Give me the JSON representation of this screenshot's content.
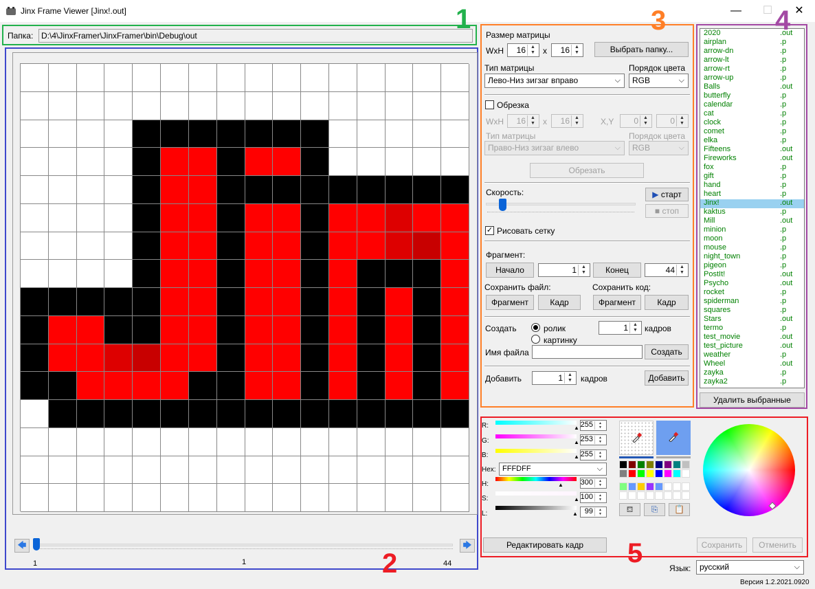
{
  "window": {
    "title": "Jinx Frame Viewer [Jinx!.out]",
    "minimize": "—",
    "maximize": "☐",
    "close": "✕"
  },
  "annotations": [
    "1",
    "2",
    "3",
    "4",
    "5"
  ],
  "folder": {
    "label": "Папка:",
    "path": "D:\\4\\JinxFramer\\JinxFramer\\bin\\Debug\\out"
  },
  "grid": {
    "rows": 16,
    "cols": 16,
    "cells": [
      "WWWWWWWWWWWWWWWW",
      "WWWWWWWWWWWWWWWW",
      "WWWWBBBBBBBWWWWW",
      "WWWWBRRBRRBWWWWW",
      "WWWWBRRBBBBBBBBB",
      "WWWWBRRBRRBRRrRR",
      "WWWWBRRBRRBRRrdR",
      "WWWWBRRBRRBRBBBR",
      "BBBBBRRBRRBRBRBR",
      "BRRBBRRBRRBRBRBR",
      "BRRrdRRBRRBRBRBR",
      "BBRRRRBBRRBRBRBR",
      "WBBBBBBBBBBBBBBB",
      "WWWWWWWWWWWWWWWW",
      "WWWWWWWWWWWWWWWW",
      "WWWWWWWWWWWWWWWW"
    ],
    "colors": {
      "W": "#ffffff",
      "B": "#000000",
      "R": "#ff0000",
      "r": "#dd0000",
      "d": "#c80000"
    }
  },
  "timeline": {
    "left_label": "1",
    "current_label": "1",
    "right_label": "44",
    "position": 0
  },
  "settings": {
    "matrix_size": "Размер матрицы",
    "wxh": "WxH",
    "width": "16",
    "x": "x",
    "height": "16",
    "choose_folder": "Выбрать папку...",
    "matrix_type_label": "Тип матрицы",
    "matrix_type": "Лево-Низ зигзаг вправо",
    "color_order_label": "Порядок цвета",
    "color_order": "RGB",
    "crop_label": "Обрезка",
    "crop_wxh": "WxH",
    "crop_w": "16",
    "crop_x": "x",
    "crop_h": "16",
    "crop_xy": "X,Y",
    "crop_xv": "0",
    "crop_yv": "0",
    "crop_type_label": "Тип матрицы",
    "crop_type": "Право-Низ зигзаг влево",
    "crop_order_label": "Порядок цвета",
    "crop_order": "RGB",
    "crop_button": "Обрезать",
    "speed_label": "Скорость:",
    "start": "старт",
    "stop": "стоп",
    "draw_grid": "Рисовать сетку",
    "fragment_label": "Фрагмент:",
    "begin": "Начало",
    "begin_value": "1",
    "end": "Конец",
    "end_value": "44",
    "save_file": "Сохранить файл:",
    "save_code": "Сохранить код:",
    "fragment_btn": "Фрагмент",
    "frame_btn": "Кадр",
    "create_label": "Создать",
    "radio_clip": "ролик",
    "radio_picture": "картинку",
    "frames_value": "1",
    "frames_label": "кадров",
    "filename_label": "Имя файла",
    "create_btn": "Создать",
    "add_label": "Добавить",
    "add_value": "1",
    "add_frames": "кадров",
    "add_btn": "Добавить"
  },
  "files": {
    "items": [
      [
        "2020",
        ".out"
      ],
      [
        "airplan",
        ".p"
      ],
      [
        "arrow-dn",
        ".p"
      ],
      [
        "arrow-lt",
        ".p"
      ],
      [
        "arrow-rt",
        ".p"
      ],
      [
        "arrow-up",
        ".p"
      ],
      [
        "Balls",
        ".out"
      ],
      [
        "butterfly",
        ".p"
      ],
      [
        "calendar",
        ".p"
      ],
      [
        "cat",
        ".p"
      ],
      [
        "clock",
        ".p"
      ],
      [
        "comet",
        ".p"
      ],
      [
        "elka",
        ".p"
      ],
      [
        "Fifteens",
        ".out"
      ],
      [
        "Fireworks",
        ".out"
      ],
      [
        "fox",
        ".p"
      ],
      [
        "gift",
        ".p"
      ],
      [
        "hand",
        ".p"
      ],
      [
        "heart",
        ".p"
      ],
      [
        "Jinx!",
        ".out"
      ],
      [
        "kaktus",
        ".p"
      ],
      [
        "Mill",
        ".out"
      ],
      [
        "minion",
        ".p"
      ],
      [
        "moon",
        ".p"
      ],
      [
        "mouse",
        ".p"
      ],
      [
        "night_town",
        ".p"
      ],
      [
        "pigeon",
        ".p"
      ],
      [
        "PostIt!",
        ".out"
      ],
      [
        "Psycho",
        ".out"
      ],
      [
        "rocket",
        ".p"
      ],
      [
        "spiderman",
        ".p"
      ],
      [
        "squares",
        ".p"
      ],
      [
        "Stars",
        ".out"
      ],
      [
        "termo",
        ".p"
      ],
      [
        "test_movie",
        ".out"
      ],
      [
        "test_picture",
        ".out"
      ],
      [
        "weather",
        ".p"
      ],
      [
        "Wheel",
        ".out"
      ],
      [
        "zayka",
        ".p"
      ],
      [
        "zayka2",
        ".p"
      ]
    ],
    "selected": 19,
    "delete_btn": "Удалить выбранные"
  },
  "color_editor": {
    "r_label": "R:",
    "r_value": "255",
    "g_label": "G:",
    "g_value": "253",
    "b_label": "B:",
    "b_value": "255",
    "hex_label": "Hex:",
    "hex_value": "FFFDFF",
    "h_label": "H:",
    "h_value": "300",
    "s_label": "S:",
    "s_value": "100",
    "l_label": "L:",
    "l_value": "99",
    "palette": [
      "#000000",
      "#800000",
      "#008000",
      "#808000",
      "#000080",
      "#800080",
      "#008080",
      "#c0c0c0",
      "#808080",
      "#ff0000",
      "#00ff00",
      "#ffff00",
      "#0000ff",
      "#ff00ff",
      "#00ffff",
      "#ffffff"
    ],
    "custom": [
      "#80ff80",
      "#6699ff",
      "#ffcc00",
      "#9933ff",
      "#6699ff",
      "#ffffff",
      "#ffffff",
      "#ffffff"
    ],
    "edit_frame": "Редактировать кадр",
    "save": "Сохранить",
    "cancel": "Отменить"
  },
  "language": {
    "label": "Язык:",
    "value": "русский"
  },
  "version": "Версия 1.2.2021.0920"
}
